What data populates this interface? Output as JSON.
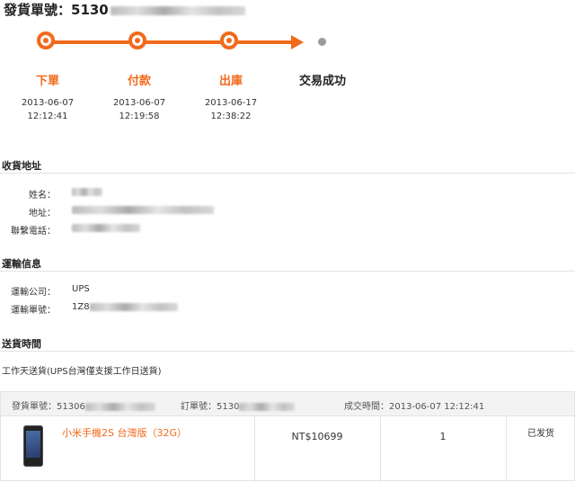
{
  "header": {
    "title_prefix": "發貨單號：5130"
  },
  "timeline": {
    "steps": [
      {
        "label": "下單",
        "date": "2013-06-07",
        "time": "12:12:41"
      },
      {
        "label": "付款",
        "date": "2013-06-07",
        "time": "12:19:58"
      },
      {
        "label": "出庫",
        "date": "2013-06-17",
        "time": "12:38:22"
      },
      {
        "label": "交易成功"
      }
    ],
    "accent": "#f26a1b"
  },
  "address": {
    "heading": "收貨地址",
    "name_label": "姓名：",
    "addr_label": "地址：",
    "phone_label": "聯繫電話："
  },
  "shipping": {
    "heading": "運輸信息",
    "company_label": "運輸公司：",
    "company_value": "UPS",
    "tracking_label": "運輸單號：",
    "tracking_prefix": "1Z8"
  },
  "delivery": {
    "heading": "送貨時間",
    "note": "工作天送貨(UPS台灣僅支援工作日送貨)"
  },
  "order_table": {
    "ship_no_label": "發貨單號：51306",
    "order_no_label": "訂單號：5130",
    "deal_time": "成交時間：2013-06-07 12:12:41",
    "row": {
      "product": "小米手機2S 台灣版（32G）",
      "price": "NT$10699",
      "qty": "1",
      "status": "已发货"
    }
  }
}
